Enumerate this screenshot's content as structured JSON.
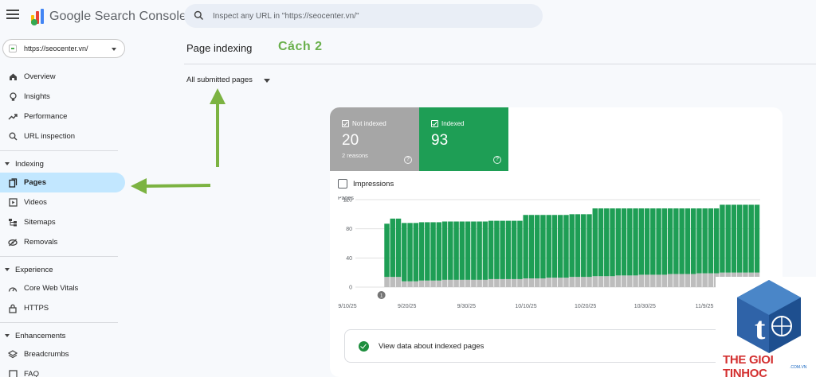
{
  "app": {
    "brand": "Google Search Console",
    "search_placeholder": "Inspect any URL in \"https://seocenter.vn/\""
  },
  "property": {
    "label": "https://seocenter.vn/"
  },
  "sidebar": {
    "top_items": [
      {
        "label": "Overview",
        "icon": "home-icon"
      },
      {
        "label": "Insights",
        "icon": "lightbulb-icon"
      },
      {
        "label": "Performance",
        "icon": "trending-up-icon"
      },
      {
        "label": "URL inspection",
        "icon": "search-icon"
      }
    ],
    "indexing": {
      "label": "Indexing",
      "items": [
        {
          "label": "Pages",
          "icon": "pages-icon",
          "active": true
        },
        {
          "label": "Videos",
          "icon": "video-icon"
        },
        {
          "label": "Sitemaps",
          "icon": "sitemap-icon"
        },
        {
          "label": "Removals",
          "icon": "removals-icon"
        }
      ]
    },
    "experience": {
      "label": "Experience",
      "items": [
        {
          "label": "Core Web Vitals",
          "icon": "speed-icon"
        },
        {
          "label": "HTTPS",
          "icon": "lock-icon"
        }
      ]
    },
    "enhancements": {
      "label": "Enhancements",
      "items": [
        {
          "label": "Breadcrumbs",
          "icon": "layers-icon"
        },
        {
          "label": "FAQ",
          "icon": "faq-icon"
        }
      ]
    }
  },
  "header": {
    "title": "Page indexing",
    "annotation": "Cách 2",
    "filter_label": "All submitted pages"
  },
  "summary": {
    "not_indexed": {
      "label": "Not indexed",
      "value": "20",
      "sub": "2 reasons",
      "color": "#a6a6a6"
    },
    "indexed": {
      "label": "Indexed",
      "value": "93",
      "color": "#1e9e55"
    }
  },
  "impressions_label": "Impressions",
  "bottom_link": "View data about indexed pages",
  "marker_label": "1",
  "watermark": {
    "text": "THE GIOI TINHOC",
    "sub": ".COM.VN"
  },
  "colors": {
    "accent_annotation": "#6ab04c",
    "active_nav": "#c2e7ff",
    "indexed": "#1e9e55",
    "not_indexed": "#bdbdbd"
  },
  "chart_data": {
    "type": "bar",
    "stacked": true,
    "ylabel": "Pages",
    "ylim": [
      0,
      120
    ],
    "yticks": [
      0,
      40,
      80,
      120
    ],
    "x_tick_labels": [
      "9/10/25",
      "9/20/25",
      "9/30/25",
      "10/10/25",
      "10/20/25",
      "10/30/25",
      "11/9/25"
    ],
    "grid": true,
    "series": [
      {
        "name": "Not indexed",
        "color": "#bdbdbd",
        "values": [
          0,
          0,
          0,
          0,
          0,
          14,
          14,
          14,
          8,
          8,
          8,
          9,
          9,
          9,
          9,
          10,
          10,
          10,
          10,
          10,
          10,
          10,
          10,
          11,
          11,
          11,
          11,
          11,
          11,
          12,
          12,
          12,
          12,
          13,
          13,
          13,
          13,
          14,
          14,
          14,
          14,
          15,
          15,
          15,
          15,
          16,
          16,
          16,
          16,
          17,
          17,
          17,
          17,
          17,
          18,
          18,
          18,
          18,
          18,
          19,
          19,
          19,
          19,
          20,
          20,
          20,
          20,
          20,
          20,
          20
        ]
      },
      {
        "name": "Indexed",
        "color": "#1e9e55",
        "values": [
          0,
          0,
          0,
          0,
          0,
          73,
          80,
          80,
          80,
          80,
          80,
          80,
          80,
          80,
          80,
          80,
          80,
          80,
          80,
          80,
          80,
          80,
          80,
          80,
          80,
          80,
          80,
          80,
          80,
          87,
          87,
          87,
          87,
          86,
          86,
          86,
          86,
          86,
          86,
          86,
          86,
          93,
          93,
          93,
          93,
          92,
          92,
          92,
          92,
          91,
          91,
          91,
          91,
          91,
          90,
          90,
          90,
          90,
          90,
          89,
          89,
          89,
          89,
          93,
          93,
          93,
          93,
          93,
          93,
          93
        ]
      }
    ]
  }
}
